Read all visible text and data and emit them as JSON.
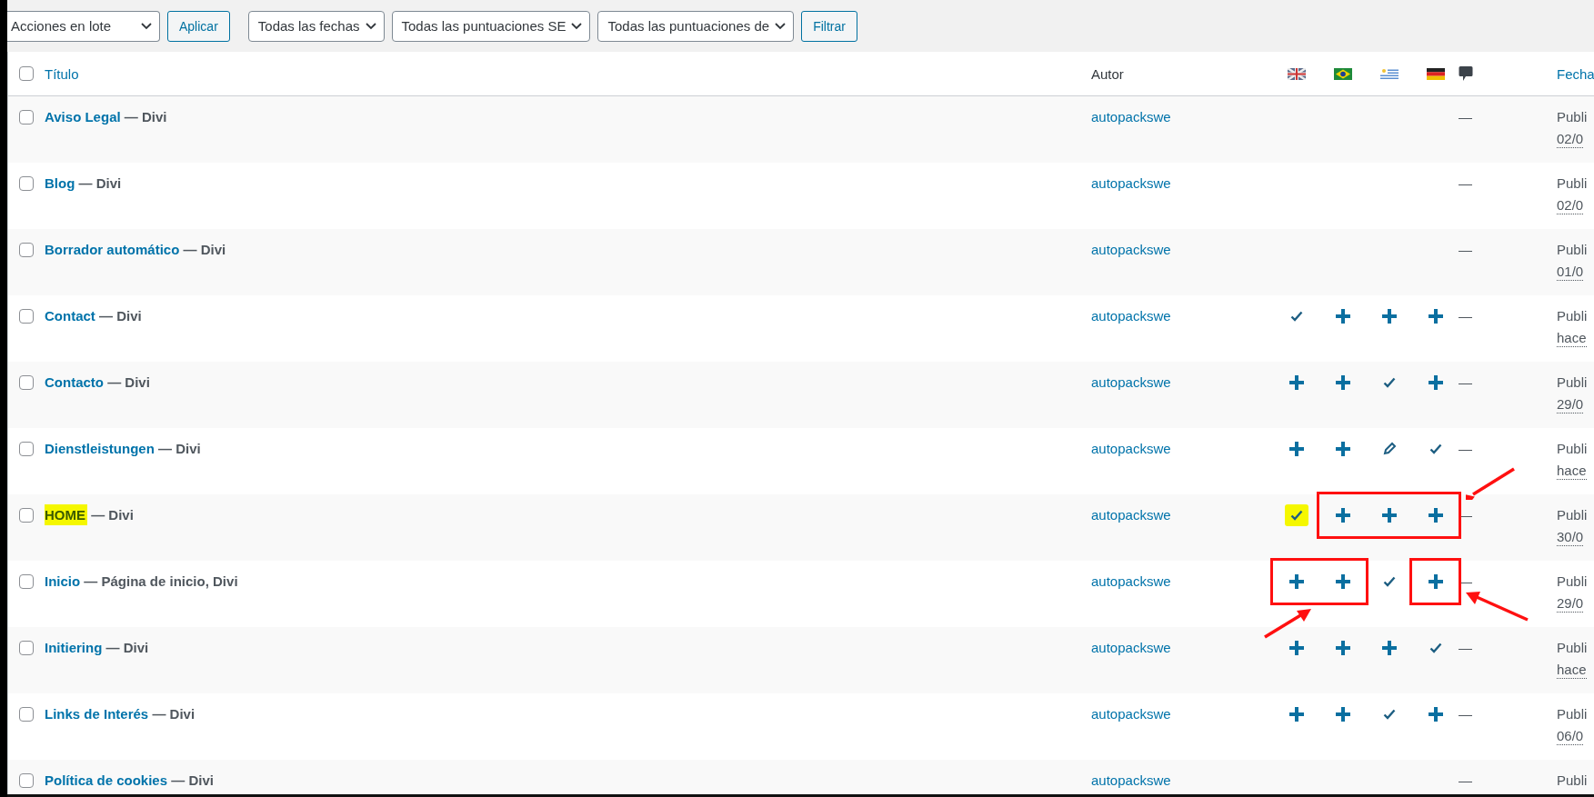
{
  "toolbar": {
    "bulk_actions": "Acciones en lote",
    "apply": "Aplicar",
    "filters": [
      "Todas las fechas",
      "Todas las puntuaciones SE",
      "Todas las puntuaciones de"
    ],
    "filter_button": "Filtrar"
  },
  "table": {
    "columns": {
      "select_all_checked": false,
      "title": "Título",
      "author": "Autor",
      "languages": [
        {
          "kind": "uk"
        },
        {
          "kind": "br"
        },
        {
          "kind": "uy"
        },
        {
          "kind": "de"
        }
      ],
      "date": "Fecha"
    },
    "rows": [
      {
        "checked": false,
        "highlighted": false,
        "title": "Aviso Legal",
        "states": "— Divi",
        "author": "autopackswe",
        "comments": "—",
        "date_status": "Publi",
        "date": "02/0"
      },
      {
        "checked": false,
        "highlighted": false,
        "title": "Blog",
        "states": "— Divi",
        "author": "autopackswe",
        "comments": "—",
        "date_status": "Publi",
        "date": "02/0"
      },
      {
        "checked": false,
        "highlighted": false,
        "title": "Borrador automático",
        "states": "— Divi",
        "author": "autopackswe",
        "comments": "—",
        "date_status": "Publi",
        "date": "01/0"
      },
      {
        "checked": false,
        "highlighted": false,
        "title": "Contact",
        "states": "— Divi",
        "author": "autopackswe",
        "languages": [
          {
            "kind": "check",
            "highlighted": false,
            "boxed": false
          },
          {
            "kind": "plus",
            "highlighted": false,
            "boxed": false
          },
          {
            "kind": "plus",
            "highlighted": false,
            "boxed": false
          },
          {
            "kind": "plus",
            "highlighted": false,
            "boxed": false
          }
        ],
        "comments": "—",
        "date_status": "Publi",
        "date": "hace"
      },
      {
        "checked": false,
        "highlighted": false,
        "title": "Contacto",
        "states": "— Divi",
        "author": "autopackswe",
        "languages": [
          {
            "kind": "plus",
            "highlighted": false,
            "boxed": false
          },
          {
            "kind": "plus",
            "highlighted": false,
            "boxed": false
          },
          {
            "kind": "check",
            "highlighted": false,
            "boxed": false
          },
          {
            "kind": "plus",
            "highlighted": false,
            "boxed": false
          }
        ],
        "comments": "—",
        "date_status": "Publi",
        "date": "29/0"
      },
      {
        "checked": false,
        "highlighted": false,
        "title": "Dienstleistungen",
        "states": "— Divi",
        "author": "autopackswe",
        "languages": [
          {
            "kind": "plus",
            "highlighted": false,
            "boxed": false
          },
          {
            "kind": "plus",
            "highlighted": false,
            "boxed": false
          },
          {
            "kind": "edit",
            "highlighted": false,
            "boxed": false
          },
          {
            "kind": "check",
            "highlighted": false,
            "boxed": false
          }
        ],
        "comments": "—",
        "date_status": "Publi",
        "date": "hace"
      },
      {
        "checked": false,
        "highlighted": true,
        "title": "HOME",
        "states": "— Divi",
        "author": "autopackswe",
        "languages": [
          {
            "kind": "check",
            "highlighted": true,
            "boxed": false
          },
          {
            "kind": "plus",
            "highlighted": false,
            "boxed": true
          },
          {
            "kind": "plus",
            "highlighted": false,
            "boxed": true
          },
          {
            "kind": "plus",
            "highlighted": false,
            "boxed": true
          }
        ],
        "arrows": [
          {
            "kind": "top-right"
          }
        ],
        "comments": "—",
        "date_status": "Publi",
        "date": "30/0"
      },
      {
        "checked": false,
        "highlighted": false,
        "title": "Inicio",
        "states": "— Página de inicio, Divi",
        "author": "autopackswe",
        "languages": [
          {
            "kind": "plus",
            "highlighted": false,
            "boxed": true
          },
          {
            "kind": "plus",
            "highlighted": false,
            "boxed": true
          },
          {
            "kind": "check",
            "highlighted": false,
            "boxed": false
          },
          {
            "kind": "plus",
            "highlighted": false,
            "boxed": true
          }
        ],
        "arrows": [
          {
            "kind": "bottom-left"
          },
          {
            "kind": "bottom-right"
          }
        ],
        "comments": "—",
        "date_status": "Publi",
        "date": "29/0"
      },
      {
        "checked": false,
        "highlighted": false,
        "title": "Initiering",
        "states": "— Divi",
        "author": "autopackswe",
        "languages": [
          {
            "kind": "plus",
            "highlighted": false,
            "boxed": false
          },
          {
            "kind": "plus",
            "highlighted": false,
            "boxed": false
          },
          {
            "kind": "plus",
            "highlighted": false,
            "boxed": false
          },
          {
            "kind": "check",
            "highlighted": false,
            "boxed": false
          }
        ],
        "comments": "—",
        "date_status": "Publi",
        "date": "hace"
      },
      {
        "checked": false,
        "highlighted": false,
        "title": "Links de Interés",
        "states": "— Divi",
        "author": "autopackswe",
        "languages": [
          {
            "kind": "plus",
            "highlighted": false,
            "boxed": false
          },
          {
            "kind": "plus",
            "highlighted": false,
            "boxed": false
          },
          {
            "kind": "check",
            "highlighted": false,
            "boxed": false
          },
          {
            "kind": "plus",
            "highlighted": false,
            "boxed": false
          }
        ],
        "comments": "—",
        "date_status": "Publi",
        "date": "06/0"
      },
      {
        "checked": false,
        "highlighted": false,
        "title": "Política de cookies",
        "states": "— Divi",
        "author": "autopackswe",
        "comments": "—",
        "date_status": "Publi"
      }
    ]
  }
}
